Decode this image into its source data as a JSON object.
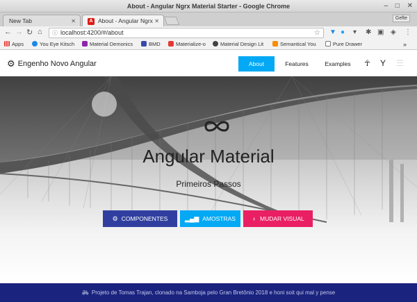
{
  "window": {
    "title": "About - Angular Ngrx Material Starter - Google Chrome"
  },
  "tabs": [
    {
      "label": "New Tab"
    },
    {
      "label": "About - Angular Ngrx"
    }
  ],
  "profile_label": "Gefte",
  "address_bar": {
    "url": "localhost:4200/#/about"
  },
  "bookmarks": [
    {
      "label": "Apps",
      "color": "#e53935"
    },
    {
      "label": "You Eye Kitsch",
      "color": "#1e88e5"
    },
    {
      "label": "Material Demonics",
      "color": "#8e24aa"
    },
    {
      "label": "BMD",
      "color": "#3949ab"
    },
    {
      "label": "Materialize-o",
      "color": "#e53935"
    },
    {
      "label": "Material Design Lit",
      "color": "#424242"
    },
    {
      "label": "Semantical You",
      "color": "#fb8c00"
    },
    {
      "label": "Pure Drawer",
      "color": "#757575"
    }
  ],
  "app": {
    "brand": "Engenho Novo Angular",
    "nav": [
      {
        "label": "About",
        "active": true
      },
      {
        "label": "Features",
        "active": false
      },
      {
        "label": "Examples",
        "active": false
      }
    ]
  },
  "hero": {
    "title": "Angular Material",
    "subtitle": "Primeiros Passos",
    "buttons": [
      {
        "label": "COMPONENTES",
        "icon": "gears-icon",
        "color": "#303f9f"
      },
      {
        "label": "AMOSTRAS",
        "icon": "signal-icon",
        "color": "#03a9f4"
      },
      {
        "label": "MUDAR VISUAL",
        "icon": "lightbulb-icon",
        "color": "#e91e63"
      }
    ]
  },
  "footer": {
    "text": "Projeto de Tomas Trajan, clonado na Samboja pelo Gran Bretônio 2018 e honi soit qui mal y pense"
  }
}
